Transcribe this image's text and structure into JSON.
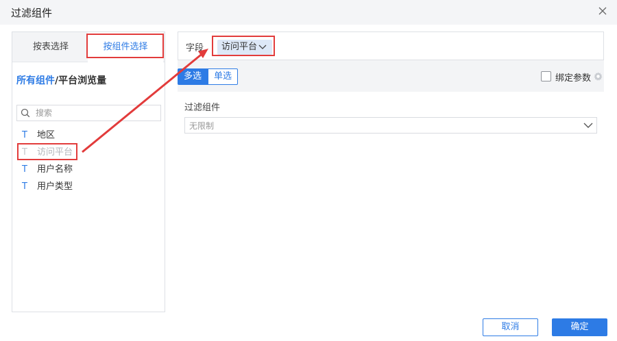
{
  "window": {
    "title": "过滤组件"
  },
  "tabs": [
    {
      "label": "按表选择",
      "active": false
    },
    {
      "label": "按组件选择",
      "active": true
    }
  ],
  "breadcrumb": {
    "link": "所有组件",
    "separator": "/",
    "current": "平台浏览量"
  },
  "search": {
    "placeholder": "搜索",
    "value": ""
  },
  "fields": [
    {
      "type_icon": "T",
      "label": "地区",
      "disabled": false
    },
    {
      "type_icon": "T",
      "label": "访问平台",
      "disabled": true
    },
    {
      "type_icon": "T",
      "label": "用户名称",
      "disabled": false
    },
    {
      "type_icon": "T",
      "label": "用户类型",
      "disabled": false
    }
  ],
  "field_row": {
    "label": "字段",
    "selected": "访问平台"
  },
  "mode": {
    "multi": "多选",
    "single": "单选",
    "active": "multi"
  },
  "bind_param": {
    "label": "绑定参数",
    "checked": false
  },
  "filter": {
    "title": "过滤组件",
    "value": "无限制"
  },
  "buttons": {
    "cancel": "取消",
    "ok": "确定"
  },
  "colors": {
    "accent": "#2d7be5",
    "annotation": "#e23b3b",
    "chip_bg": "#dde8f7"
  }
}
